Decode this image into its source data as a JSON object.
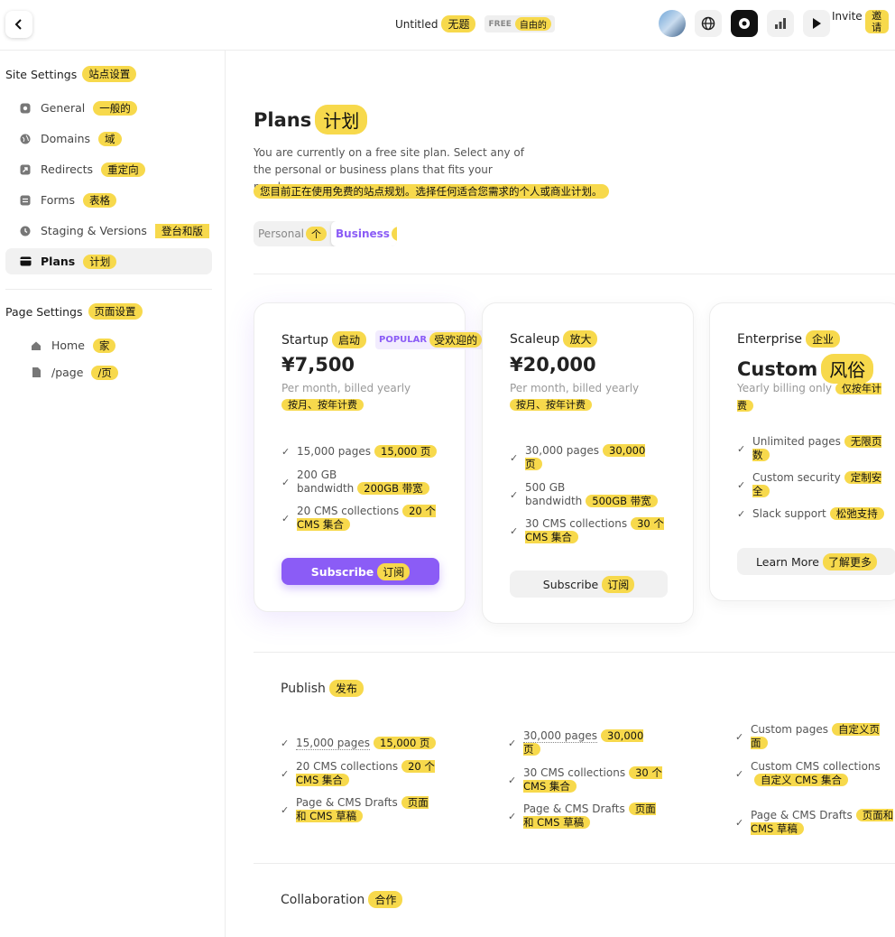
{
  "header": {
    "title": "Untitled",
    "title_cn": "无题",
    "badge": "FREE",
    "badge_cn": "自由的",
    "invite": "Invite",
    "invite_cn": "邀请"
  },
  "sidebar": {
    "site_settings": "Site Settings",
    "site_settings_cn": "站点设置",
    "items": [
      {
        "label": "General",
        "cn": "一般的",
        "icon": "gear-icon"
      },
      {
        "label": "Domains",
        "cn": "域",
        "icon": "globe-icon"
      },
      {
        "label": "Redirects",
        "cn": "重定向",
        "icon": "redirect-arrow-icon"
      },
      {
        "label": "Forms",
        "cn": "表格",
        "icon": "form-icon"
      },
      {
        "label": "Staging & Versions",
        "cn": "登台和版",
        "icon": "clock-icon"
      },
      {
        "label": "Plans",
        "cn": "计划",
        "icon": "card-icon"
      }
    ],
    "page_settings": "Page Settings",
    "page_settings_cn": "页面设置",
    "pages": [
      {
        "label": "Home",
        "cn": "家",
        "icon": "home-icon"
      },
      {
        "label": "/page",
        "cn": "/页",
        "icon": "file-icon"
      }
    ]
  },
  "main": {
    "title": "Plans",
    "title_cn": "计划",
    "description": "You are currently on a free site plan. Select any of the personal or business plans that fits your needs.",
    "description_cn": "您目前正在使用免费的站点规划。选择任何适合您需求的个人或商业计划。",
    "tabs": [
      {
        "label": "Personal",
        "cn": "个"
      },
      {
        "label": "Business",
        "cn": "商"
      }
    ],
    "plans": [
      {
        "name": "Startup",
        "name_cn": "启动",
        "popular": "POPULAR",
        "popular_cn": "受欢迎的",
        "price": "¥7,500",
        "billing": "Per month, billed yearly",
        "billing_cn": "按月、按年计费",
        "features": [
          {
            "text": "15,000 pages",
            "cn": "15,000 页"
          },
          {
            "text": "200 GB bandwidth",
            "cn": "200GB 带宽"
          },
          {
            "text": "20 CMS collections",
            "cn": "20 个 CMS 集合"
          }
        ],
        "button": "Subscribe",
        "button_cn": "订阅"
      },
      {
        "name": "Scaleup",
        "name_cn": "放大",
        "price": "¥20,000",
        "billing": "Per month, billed yearly",
        "billing_cn": "按月、按年计费",
        "features": [
          {
            "text": "30,000 pages",
            "cn": "30,000 页"
          },
          {
            "text": "500 GB bandwidth",
            "cn": "500GB 带宽"
          },
          {
            "text": "30 CMS collections",
            "cn": "30 个 CMS 集合"
          }
        ],
        "button": "Subscribe",
        "button_cn": "订阅"
      },
      {
        "name": "Enterprise",
        "name_cn": "企业",
        "price": "Custom",
        "price_cn": "风俗",
        "billing": "Yearly billing only",
        "billing_cn": "仅按年计费",
        "features": [
          {
            "text": "Unlimited pages",
            "cn": "无限页数"
          },
          {
            "text": "Custom security",
            "cn": "定制安全"
          },
          {
            "text": "Slack support",
            "cn": "松弛支持"
          }
        ],
        "button": "Learn More",
        "button_cn": "了解更多"
      }
    ],
    "publish": {
      "label": "Publish",
      "label_cn": "发布",
      "columns": [
        [
          {
            "text": "15,000 pages",
            "cn": "15,000 页"
          },
          {
            "text": "20 CMS collections",
            "cn": "20 个 CMS 集合"
          },
          {
            "text": "Page & CMS Drafts",
            "cn": "页面和 CMS 草稿"
          }
        ],
        [
          {
            "text": "30,000 pages",
            "cn": "30,000 页"
          },
          {
            "text": "30 CMS collections",
            "cn": "30 个 CMS 集合"
          },
          {
            "text": "Page & CMS Drafts",
            "cn": "页面和 CMS 草稿"
          }
        ],
        [
          {
            "text": "Custom pages",
            "cn": "自定义页面"
          },
          {
            "text": "Custom CMS collections",
            "cn": "自定义 CMS 集合"
          },
          {
            "text": "Page & CMS Drafts",
            "cn": "页面和 CMS 草稿"
          }
        ]
      ]
    },
    "collaboration": {
      "label": "Collaboration",
      "label_cn": "合作"
    }
  }
}
